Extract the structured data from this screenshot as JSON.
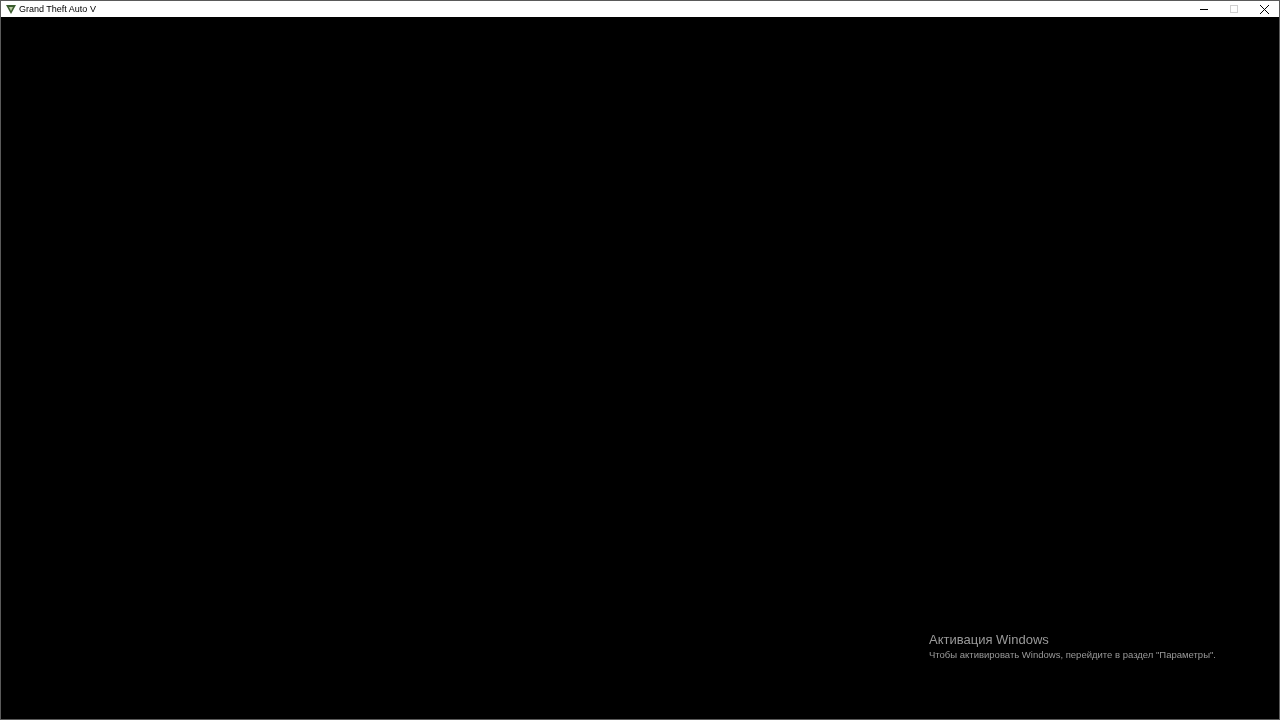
{
  "window": {
    "title": "Grand Theft Auto V",
    "maximize_disabled": true
  },
  "activation_notice": {
    "title": "Активация Windows",
    "message": "Чтобы активировать Windows, перейдите в раздел \"Параметры\"."
  }
}
